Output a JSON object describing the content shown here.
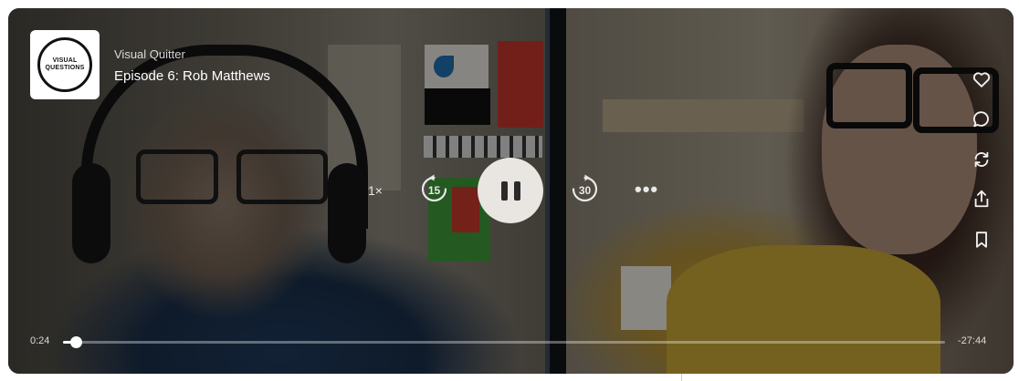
{
  "podcast": {
    "show_name": "Visual Quitter",
    "episode_title": "Episode 6: Rob Matthews",
    "logo_text": "VISUAL QUESTIONS"
  },
  "controls": {
    "speed_label": "1×",
    "skip_back_label": "15",
    "skip_forward_label": "30",
    "more_label": "•••",
    "play_state": "playing",
    "pause_icon": "pause-icon"
  },
  "side_actions": [
    {
      "name": "like",
      "icon": "heart-icon"
    },
    {
      "name": "comment",
      "icon": "comment-icon"
    },
    {
      "name": "repost",
      "icon": "repost-icon"
    },
    {
      "name": "share",
      "icon": "share-icon"
    },
    {
      "name": "bookmark",
      "icon": "bookmark-icon"
    }
  ],
  "progress": {
    "current_time": "0:24",
    "remaining_time": "-27:44",
    "fraction": 0.014
  }
}
